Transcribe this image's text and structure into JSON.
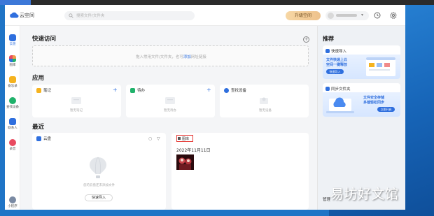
{
  "taskbar": {
    "tab_label": "首页"
  },
  "app": {
    "title": "云空间"
  },
  "search": {
    "placeholder": "搜索文件/文件夹"
  },
  "header": {
    "upgrade_label": "升级空间"
  },
  "sidebar": {
    "items": [
      {
        "label": "云盘",
        "icon": "cloud-icon",
        "color": "#2f6fde"
      },
      {
        "label": "图库",
        "icon": "gallery-icon",
        "color": "#f2994a"
      },
      {
        "label": "备忘录",
        "icon": "memo-icon",
        "color": "#f5b31f"
      },
      {
        "label": "查找设备",
        "icon": "locate-icon",
        "color": "#20b26b"
      },
      {
        "label": "联系人",
        "icon": "contacts-icon",
        "color": "#2f6fde"
      },
      {
        "label": "录音",
        "icon": "recorder-icon",
        "color": "#e84a5f"
      }
    ],
    "bottom_label": "小程序"
  },
  "quick_access": {
    "title": "快速访问",
    "hint_prefix": "拖入常用文件/文件夹，也可",
    "hint_link": "添加",
    "hint_suffix": "网址链接"
  },
  "apps": {
    "title": "应用",
    "cards": [
      {
        "name": "笔记",
        "empty": "暂无笔记",
        "color": "#f5b31f"
      },
      {
        "name": "待办",
        "empty": "暂无待办",
        "color": "#20b26b"
      },
      {
        "name": "查找设备",
        "empty": "暂无设备",
        "color": "#2f6fde"
      }
    ]
  },
  "recent": {
    "title": "最近",
    "drive_card": {
      "name": "云盘",
      "empty": "您的云盘还未添加文件",
      "import_label": "快速导入"
    },
    "gallery_card": {
      "name": "图库",
      "date": "2022年11月11日"
    }
  },
  "panel": {
    "title": "推荐",
    "promos": [
      {
        "head": "快速导入",
        "line1": "文件快速上云",
        "line2": "空间一键释放",
        "button": "快速导入"
      },
      {
        "head": "同步文件夹",
        "line1": "文件安全存储",
        "line2": "多端轻松同步",
        "button": "立即开启"
      }
    ],
    "storage_label": "管理"
  },
  "watermark": "易坊好文馆"
}
